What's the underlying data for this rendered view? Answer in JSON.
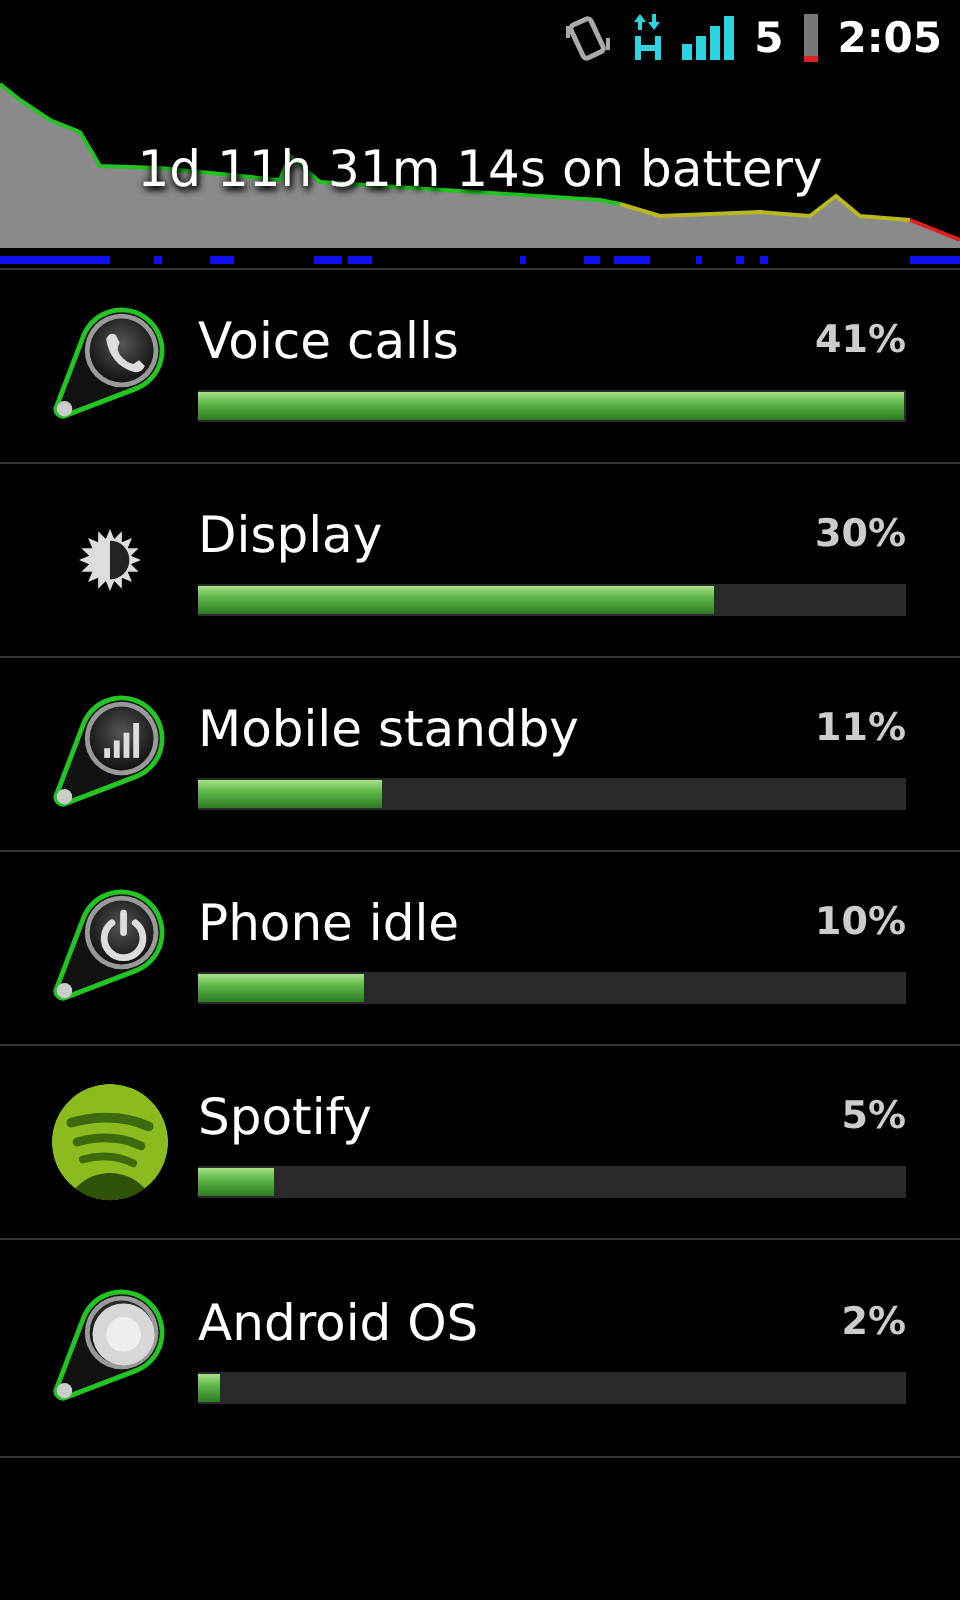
{
  "status_bar": {
    "signal_label": "5",
    "time": "2:05"
  },
  "battery_graph": {
    "caption": "1d 11h 31m 14s on battery"
  },
  "usage_items": [
    {
      "kind": "phone",
      "name": "Voice calls",
      "percent": "41%",
      "level": 1
    },
    {
      "kind": "display",
      "name": "Display",
      "percent": "30%",
      "level": 0.73
    },
    {
      "kind": "signal",
      "name": "Mobile standby",
      "percent": "11%",
      "level": 0.26
    },
    {
      "kind": "power",
      "name": "Phone idle",
      "percent": "10%",
      "level": 0.235
    },
    {
      "kind": "spotify",
      "name": "Spotify",
      "percent": "5%",
      "level": 0.107
    },
    {
      "kind": "os",
      "name": "Android OS",
      "percent": "2%",
      "level": 0.03
    }
  ]
}
